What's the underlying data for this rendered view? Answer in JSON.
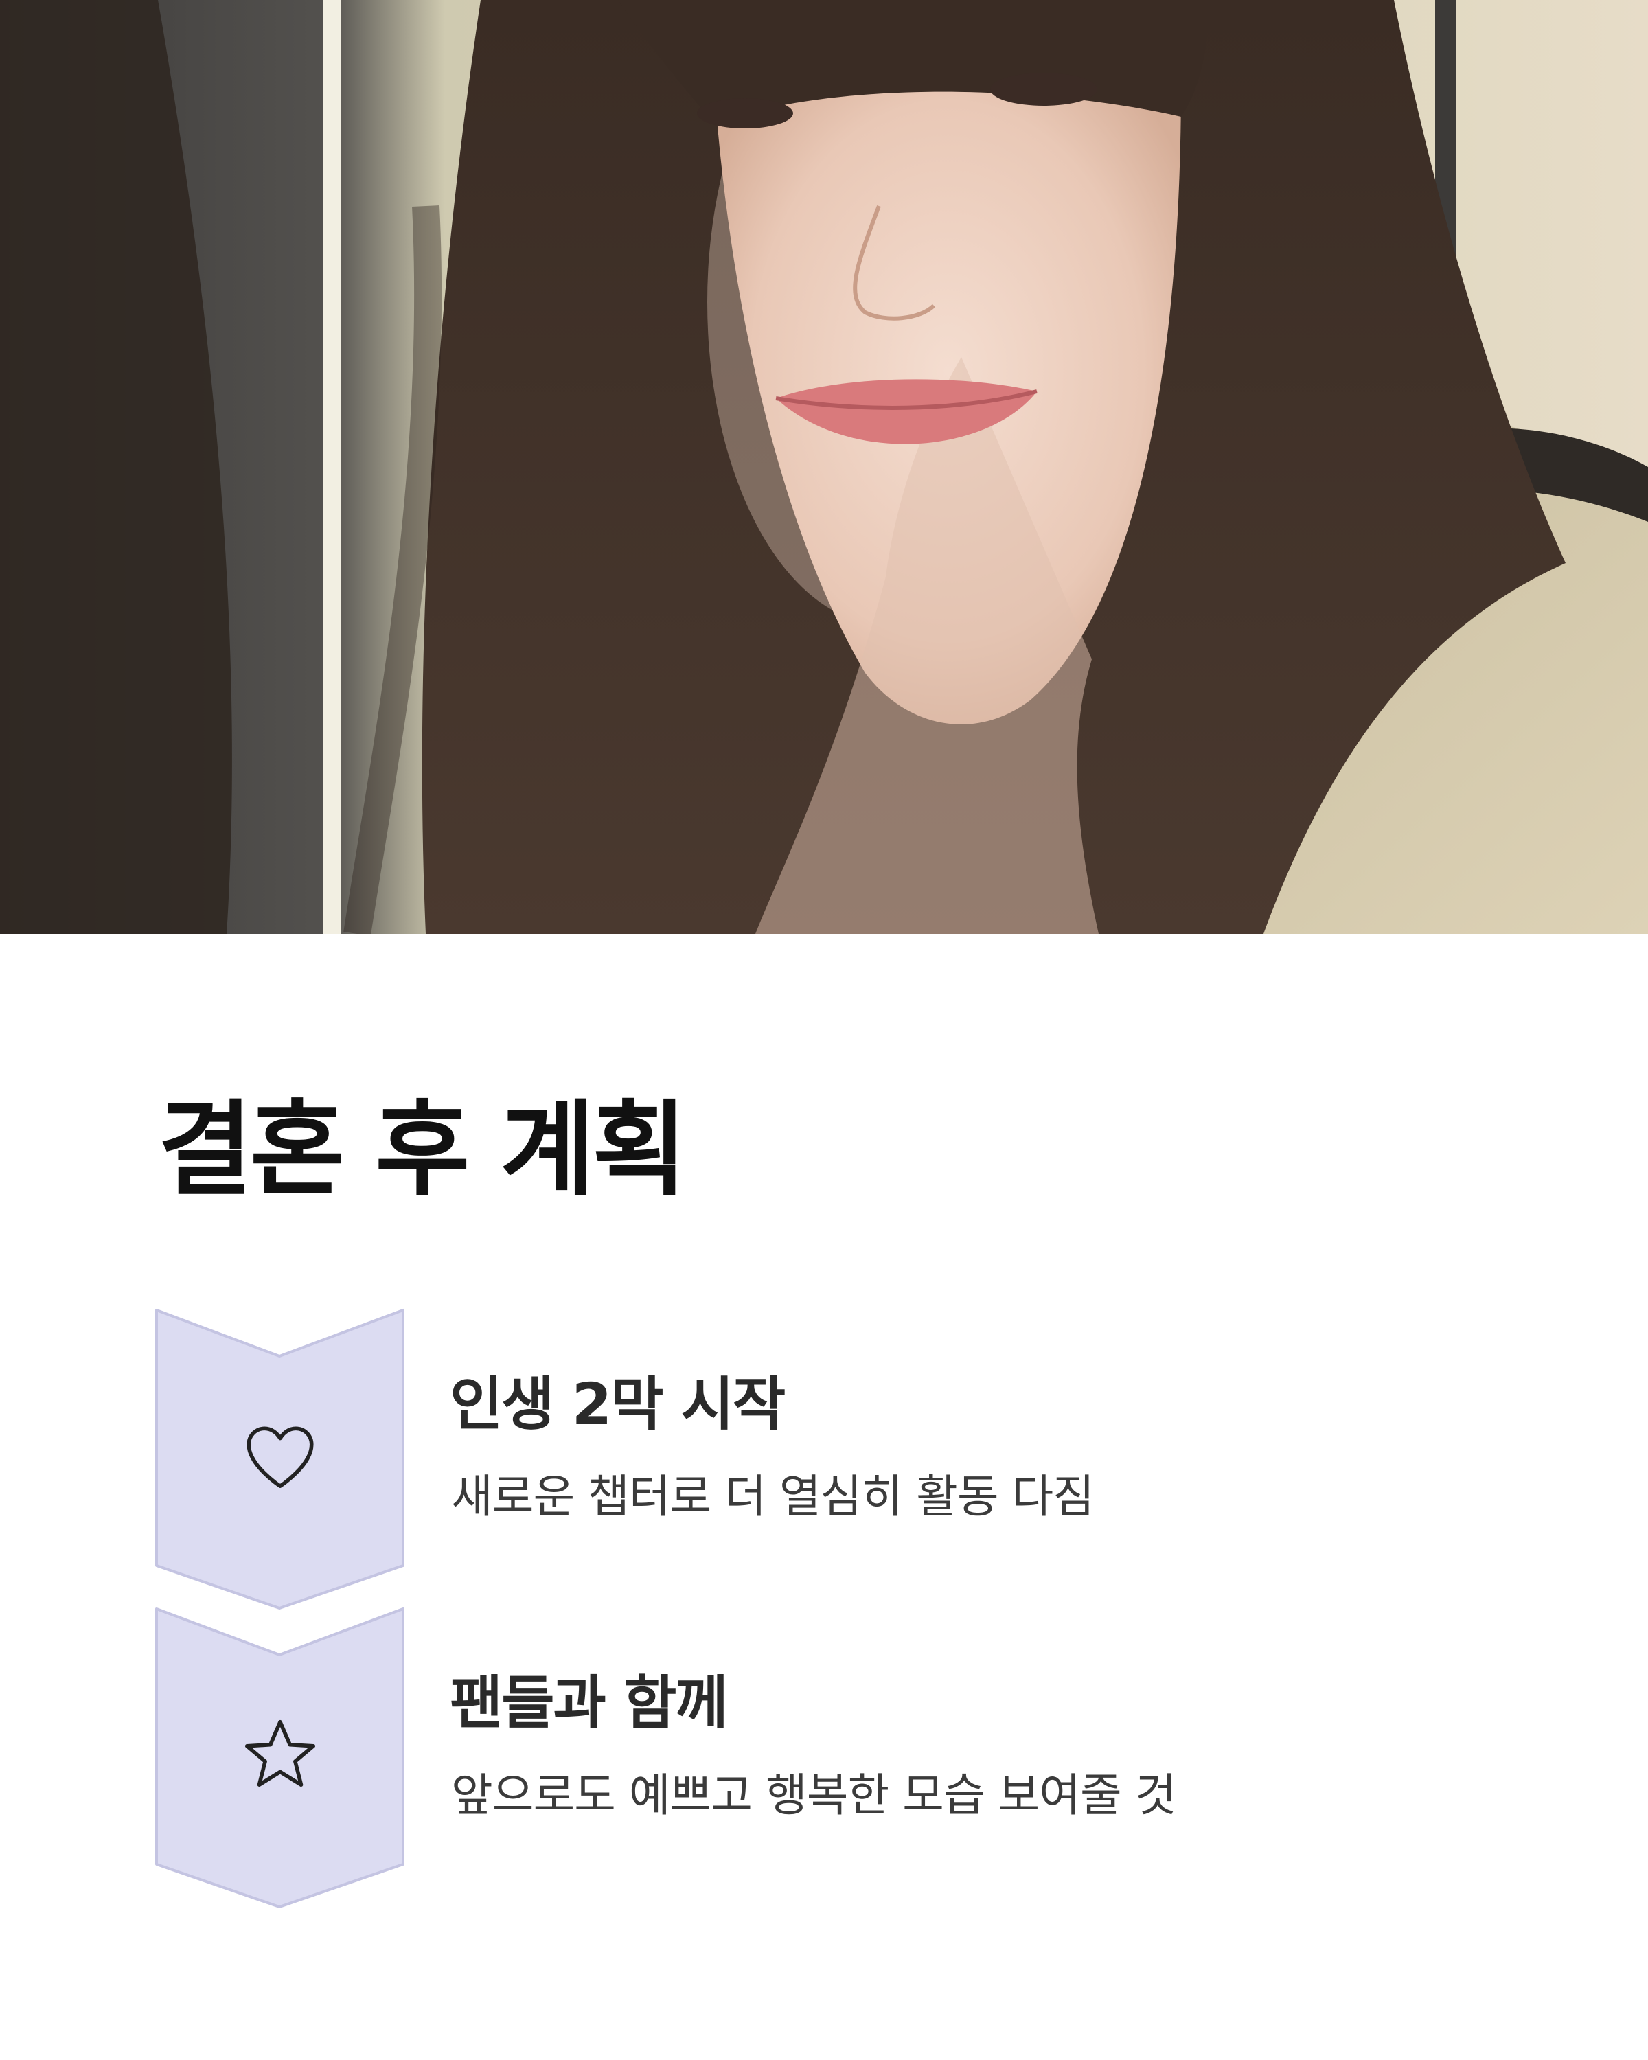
{
  "photo": {
    "subject": "smiling woman with long dark hair and bangs, selfie"
  },
  "section": {
    "title": "결혼 후 계획"
  },
  "items": [
    {
      "icon": "heart-icon",
      "title": "인생 2막 시작",
      "description": "새로운 챕터로 더 열심히 활동 다짐"
    },
    {
      "icon": "star-icon",
      "title": "팬들과 함께",
      "description": "앞으로도 예쁘고 행복한 모습 보여줄 것"
    }
  ],
  "colors": {
    "badge_fill": "#dcdcf2",
    "badge_stroke": "#c4c4e2",
    "title_text": "#111111",
    "body_text": "#3b3b3b"
  }
}
